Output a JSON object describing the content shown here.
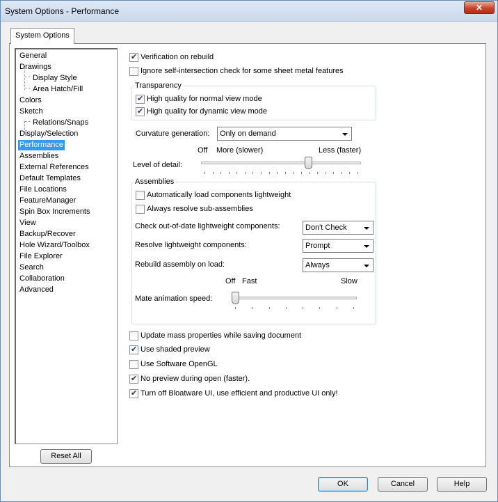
{
  "window": {
    "title": "System Options - Performance",
    "close_glyph": "✕"
  },
  "tab": {
    "label": "System Options"
  },
  "nav": {
    "items": [
      {
        "label": "General"
      },
      {
        "label": "Drawings"
      },
      {
        "label": "Display Style"
      },
      {
        "label": "Area Hatch/Fill"
      },
      {
        "label": "Colors"
      },
      {
        "label": "Sketch"
      },
      {
        "label": "Relations/Snaps"
      },
      {
        "label": "Display/Selection"
      },
      {
        "label": "Performance"
      },
      {
        "label": "Assemblies"
      },
      {
        "label": "External References"
      },
      {
        "label": "Default Templates"
      },
      {
        "label": "File Locations"
      },
      {
        "label": "FeatureManager"
      },
      {
        "label": "Spin Box Increments"
      },
      {
        "label": "View"
      },
      {
        "label": "Backup/Recover"
      },
      {
        "label": "Hole Wizard/Toolbox"
      },
      {
        "label": "File Explorer"
      },
      {
        "label": "Search"
      },
      {
        "label": "Collaboration"
      },
      {
        "label": "Advanced"
      }
    ],
    "selected": "Performance",
    "reset_label": "Reset All"
  },
  "top_checks": {
    "verification": {
      "label": "Verification on rebuild",
      "checked": true
    },
    "ignore_self_intersection": {
      "label": "Ignore self-intersection check for some sheet metal features",
      "checked": false
    }
  },
  "transparency": {
    "title": "Transparency",
    "normal": {
      "label": "High quality for normal view mode",
      "checked": true
    },
    "dynamic": {
      "label": "High quality for dynamic view mode",
      "checked": true
    }
  },
  "curvature": {
    "label": "Curvature generation:",
    "value": "Only on demand"
  },
  "level_of_detail": {
    "label": "Level of detail:",
    "off_label": "Off",
    "more_label": "More (slower)",
    "less_label": "Less (faster)",
    "position_fraction": 0.68
  },
  "assemblies": {
    "title": "Assemblies",
    "auto_lightweight": {
      "label": "Automatically load components lightweight",
      "checked": false
    },
    "resolve_sub": {
      "label": "Always resolve sub-assemblies",
      "checked": false
    },
    "check_out_of_date": {
      "label": "Check out-of-date lightweight components:",
      "value": "Don't Check"
    },
    "resolve_lightweight": {
      "label": "Resolve lightweight components:",
      "value": "Prompt"
    },
    "rebuild_on_load": {
      "label": "Rebuild assembly on load:",
      "value": "Always"
    },
    "mate_animation": {
      "label": "Mate animation speed:",
      "off_label": "Off",
      "fast_label": "Fast",
      "slow_label": "Slow",
      "position_fraction": 0.0
    }
  },
  "bottom_checks": {
    "update_mass": {
      "label": "Update mass properties while saving document",
      "checked": false
    },
    "shaded_preview": {
      "label": "Use shaded preview",
      "checked": true
    },
    "software_opengl": {
      "label": "Use Software OpenGL",
      "checked": false
    },
    "no_preview": {
      "label": "No preview during open (faster).",
      "checked": true
    },
    "bloatware": {
      "label": "Turn off Bloatware UI, use efficient and productive UI only!",
      "checked": true
    }
  },
  "footer": {
    "ok": "OK",
    "cancel": "Cancel",
    "help": "Help"
  }
}
